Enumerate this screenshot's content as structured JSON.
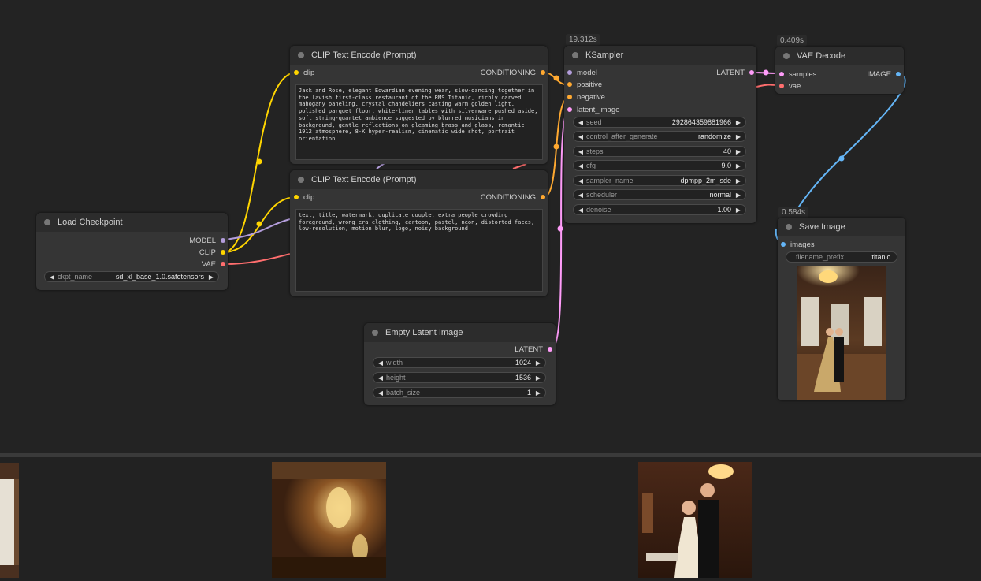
{
  "colors": {
    "model": "#b39ddb",
    "clip": "#ffd500",
    "vae": "#ff6e6e",
    "conditioning": "#ffa931",
    "latent": "#ff9cf9",
    "image": "#64b5f6"
  },
  "nodes": {
    "load_checkpoint": {
      "title": "Load Checkpoint",
      "outputs": [
        "MODEL",
        "CLIP",
        "VAE"
      ],
      "ckpt_label": "ckpt_name",
      "ckpt_value": "sd_xl_base_1.0.safetensors"
    },
    "clip_pos": {
      "title": "CLIP Text Encode (Prompt)",
      "input": "clip",
      "output": "CONDITIONING",
      "text": "Jack and Rose, elegant Edwardian evening wear, slow-dancing together in the lavish first-class restaurant of the RMS Titanic, richly carved mahogany paneling, crystal chandeliers casting warm golden light, polished parquet floor, white-linen tables with silverware pushed aside, soft string-quartet ambience suggested by blurred musicians in background, gentle reflections on gleaming brass and glass, romantic 1912 atmosphere, 8-K hyper-realism, cinematic wide shot, portrait orientation"
    },
    "clip_neg": {
      "title": "CLIP Text Encode (Prompt)",
      "input": "clip",
      "output": "CONDITIONING",
      "text": "text, title, watermark, duplicate couple, extra people crowding foreground, wrong era clothing, cartoon, pastel, neon, distorted faces, low-resolution, motion blur, logo, noisy background"
    },
    "ksampler": {
      "title": "KSampler",
      "timing": "19.312s",
      "inputs": [
        "model",
        "positive",
        "negative",
        "latent_image"
      ],
      "output": "LATENT",
      "widgets": [
        {
          "label": "seed",
          "value": "292864359881966"
        },
        {
          "label": "control_after_generate",
          "value": "randomize"
        },
        {
          "label": "steps",
          "value": "40"
        },
        {
          "label": "cfg",
          "value": "9.0"
        },
        {
          "label": "sampler_name",
          "value": "dpmpp_2m_sde"
        },
        {
          "label": "scheduler",
          "value": "normal"
        },
        {
          "label": "denoise",
          "value": "1.00"
        }
      ]
    },
    "vae_decode": {
      "title": "VAE Decode",
      "timing": "0.409s",
      "inputs": [
        "samples",
        "vae"
      ],
      "output": "IMAGE"
    },
    "save_image": {
      "title": "Save Image",
      "timing": "0.584s",
      "input": "images",
      "prefix_label": "filename_prefix",
      "prefix_value": "titanic"
    },
    "empty_latent": {
      "title": "Empty Latent Image",
      "output": "LATENT",
      "widgets": [
        {
          "label": "width",
          "value": "1024"
        },
        {
          "label": "height",
          "value": "1536"
        },
        {
          "label": "batch_size",
          "value": "1"
        }
      ]
    }
  }
}
